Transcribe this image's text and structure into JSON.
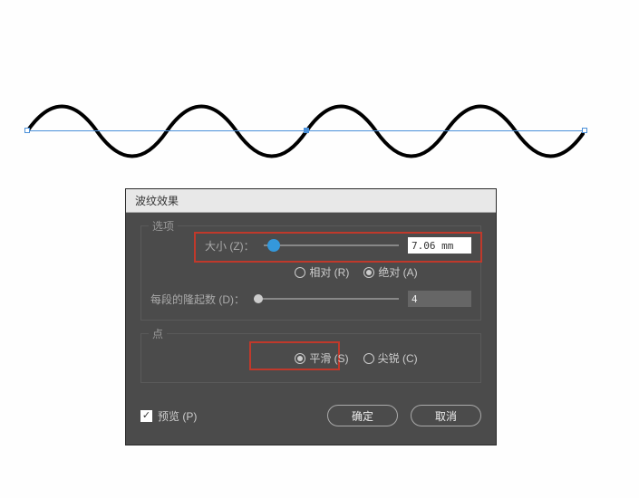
{
  "dialog": {
    "title": "波纹效果",
    "options_group_label": "选项",
    "size_label": "大小 (Z)：",
    "size_value": "7.06 mm",
    "relative_label": "相对 (R)",
    "absolute_label": "绝对 (A)",
    "size_mode": "absolute",
    "ridges_label": "每段的隆起数 (D)：",
    "ridges_value": "4",
    "point_group_label": "点",
    "smooth_label": "平滑 (S)",
    "corner_label": "尖锐 (C)",
    "point_mode": "smooth",
    "preview_label": "预览 (P)",
    "preview_checked": true,
    "ok_label": "确定",
    "cancel_label": "取消"
  }
}
